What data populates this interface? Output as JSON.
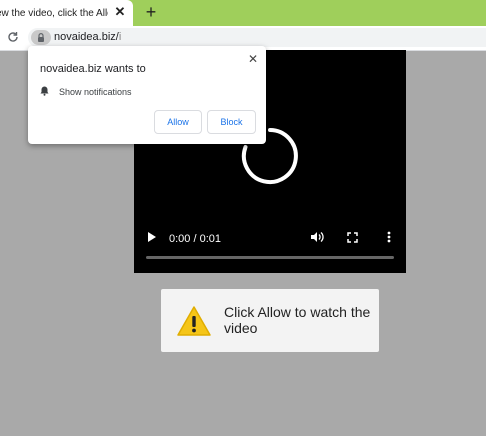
{
  "tab": {
    "title": "ew the video, click the Allow",
    "close_glyph": "✕",
    "new_tab_glyph": "+"
  },
  "toolbar": {
    "reload_glyph": "C",
    "url": "novaidea.biz/",
    "url_caret": "i"
  },
  "video": {
    "time": "0:00 / 0:01",
    "progress_fraction": 0.0
  },
  "permission_popup": {
    "title": "novaidea.biz wants to",
    "permission": "Show notifications",
    "allow_label": "Allow",
    "block_label": "Block",
    "close_glyph": "✕"
  },
  "notice": {
    "text": "Click Allow to watch the video",
    "icon": "warning-icon"
  },
  "colors": {
    "tabbar": "#9fcf5b",
    "page_background": "#a9a9a9",
    "button_text": "#1a73e8",
    "warning_fill": "#f5c518"
  }
}
